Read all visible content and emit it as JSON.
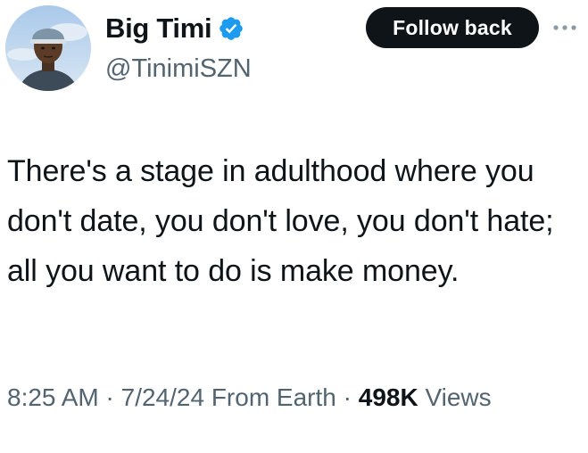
{
  "author": {
    "display_name": "Big Timi",
    "handle": "@TinimiSZN",
    "verified": true,
    "avatar_icon": "profile-photo"
  },
  "actions": {
    "follow_label": "Follow back",
    "more_icon": "more-dots-icon"
  },
  "tweet": {
    "text": "There's a stage in adulthood where you don't date, you don't love, you don't hate; all you want to do is make money."
  },
  "meta": {
    "time": "8:25 AM",
    "separator": "·",
    "date": "7/24/24",
    "source": "From Earth",
    "views_count": "498K",
    "views_label": "Views"
  },
  "colors": {
    "text_primary": "#0f1419",
    "text_secondary": "#536471",
    "verified_blue": "#1d9bf0",
    "button_bg": "#0f1419"
  }
}
